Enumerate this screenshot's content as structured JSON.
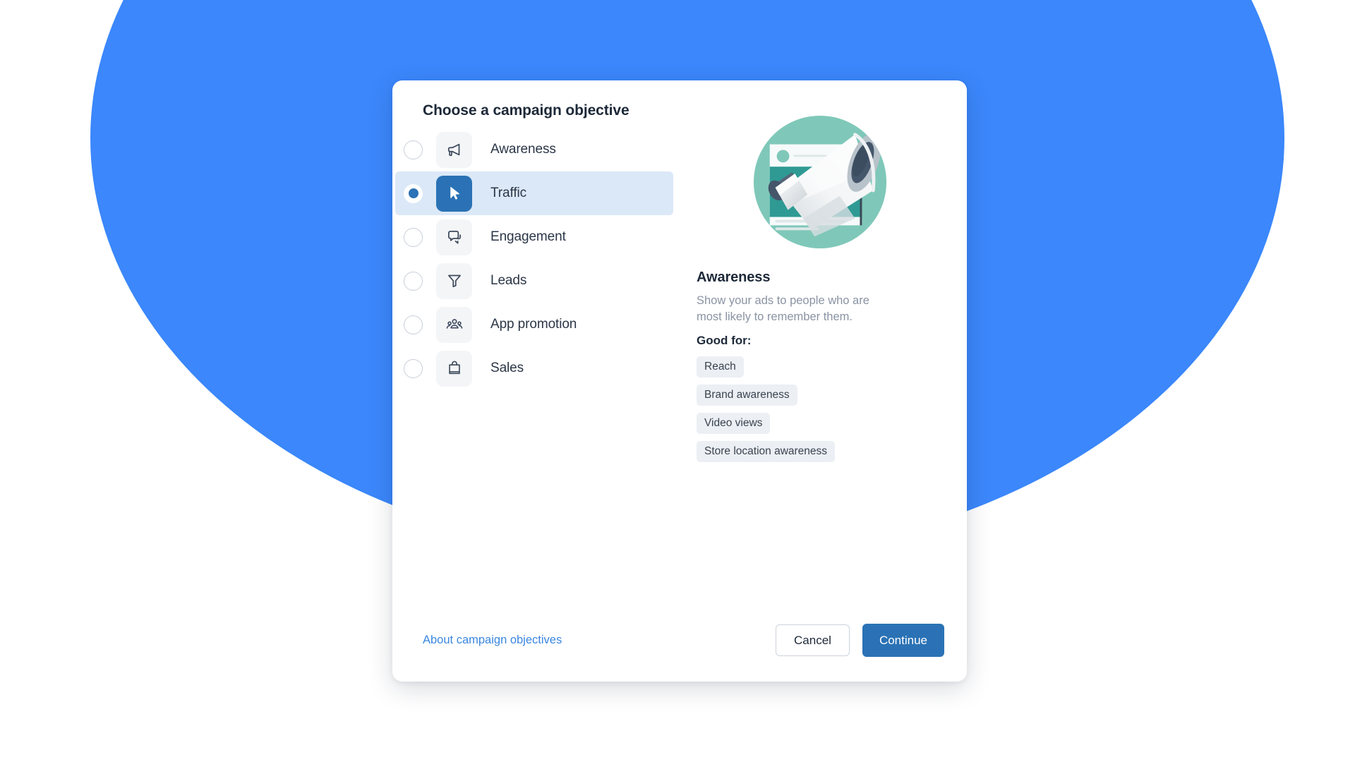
{
  "background": {
    "blob_color": "#3b87fb",
    "page_color": "#ffffff"
  },
  "dialog": {
    "title": "Choose a campaign objective",
    "selected_index": 1,
    "accent_color": "#2a72b5",
    "selected_row_bg": "#dbe8f7",
    "objectives": [
      {
        "label": "Awareness",
        "icon": "megaphone-icon"
      },
      {
        "label": "Traffic",
        "icon": "cursor-arrow-icon"
      },
      {
        "label": "Engagement",
        "icon": "chat-bubbles-icon"
      },
      {
        "label": "Leads",
        "icon": "funnel-icon"
      },
      {
        "label": "App promotion",
        "icon": "people-group-icon"
      },
      {
        "label": "Sales",
        "icon": "shopping-bag-icon"
      }
    ],
    "detail": {
      "illustration": "megaphone-illustration",
      "title": "Awareness",
      "description": "Show your ads to people who are most likely to remember them.",
      "good_for_label": "Good for:",
      "chips": [
        "Reach",
        "Brand awareness",
        "Video views",
        "Store location awareness"
      ]
    },
    "footer": {
      "about_link": "About campaign objectives",
      "cancel_label": "Cancel",
      "continue_label": "Continue"
    }
  }
}
